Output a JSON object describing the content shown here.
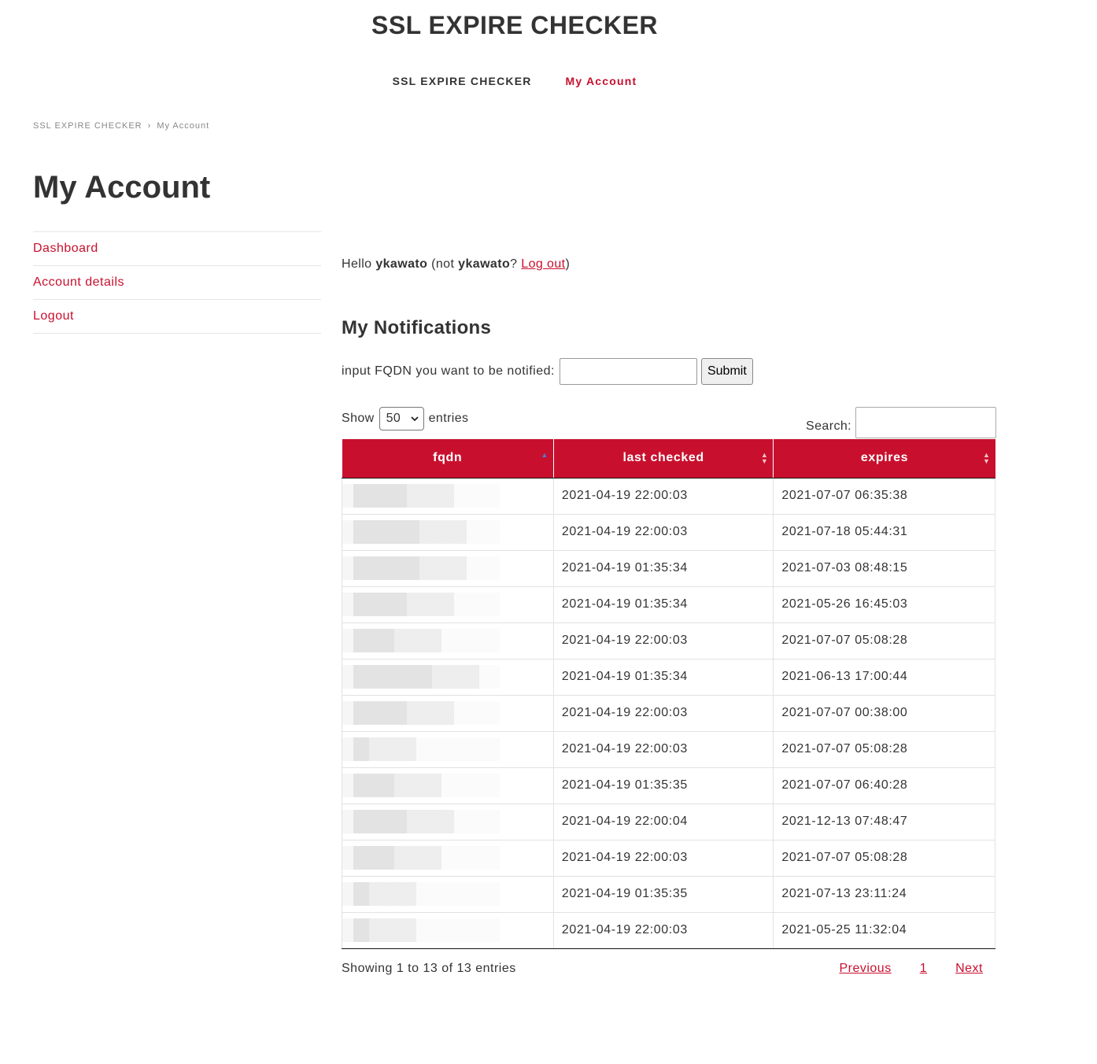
{
  "site": {
    "title": "SSL EXPIRE CHECKER"
  },
  "nav": [
    {
      "label": "SSL EXPIRE CHECKER"
    },
    {
      "label": "My Account"
    }
  ],
  "breadcrumb": {
    "home": "SSL EXPIRE CHECKER",
    "separator": "›",
    "current": "My Account"
  },
  "page_title": "My Account",
  "account_nav": [
    {
      "label": "Dashboard"
    },
    {
      "label": "Account details"
    },
    {
      "label": "Logout"
    }
  ],
  "greeting": {
    "hello": "Hello",
    "user": "ykawato",
    "not": "(not",
    "user2": "ykawato",
    "question": "?",
    "logout": "Log out",
    "close": ")"
  },
  "notifications": {
    "title": "My Notifications",
    "form_label": "input FQDN you want to be notified:",
    "input_value": "",
    "submit": "Submit"
  },
  "table_controls": {
    "show": "Show",
    "entries_value": "50",
    "entries": "entries",
    "search_label": "Search:",
    "search_value": ""
  },
  "table": {
    "columns": [
      "fqdn",
      "last checked",
      "expires"
    ],
    "sort_column": "fqdn",
    "rows": [
      {
        "fqdn": "",
        "last_checked": "2021-04-19 22:00:03",
        "expires": "2021-07-07 06:35:38"
      },
      {
        "fqdn": "",
        "last_checked": "2021-04-19 22:00:03",
        "expires": "2021-07-18 05:44:31"
      },
      {
        "fqdn": "",
        "last_checked": "2021-04-19 01:35:34",
        "expires": "2021-07-03 08:48:15"
      },
      {
        "fqdn": "",
        "last_checked": "2021-04-19 01:35:34",
        "expires": "2021-05-26 16:45:03"
      },
      {
        "fqdn": "",
        "last_checked": "2021-04-19 22:00:03",
        "expires": "2021-07-07 05:08:28"
      },
      {
        "fqdn": "",
        "last_checked": "2021-04-19 01:35:34",
        "expires": "2021-06-13 17:00:44"
      },
      {
        "fqdn": "",
        "last_checked": "2021-04-19 22:00:03",
        "expires": "2021-07-07 00:38:00"
      },
      {
        "fqdn": "",
        "last_checked": "2021-04-19 22:00:03",
        "expires": "2021-07-07 05:08:28"
      },
      {
        "fqdn": "",
        "last_checked": "2021-04-19 01:35:35",
        "expires": "2021-07-07 06:40:28"
      },
      {
        "fqdn": "",
        "last_checked": "2021-04-19 22:00:04",
        "expires": "2021-12-13 07:48:47"
      },
      {
        "fqdn": "",
        "last_checked": "2021-04-19 22:00:03",
        "expires": "2021-07-07 05:08:28"
      },
      {
        "fqdn": "",
        "last_checked": "2021-04-19 01:35:35",
        "expires": "2021-07-13 23:11:24"
      },
      {
        "fqdn": "",
        "last_checked": "2021-04-19 22:00:03",
        "expires": "2021-05-25 11:32:04"
      }
    ]
  },
  "footer": {
    "info": "Showing 1 to 13 of 13 entries",
    "previous": "Previous",
    "page": "1",
    "next": "Next"
  },
  "colors": {
    "accent": "#c8102e",
    "text": "#333333"
  }
}
